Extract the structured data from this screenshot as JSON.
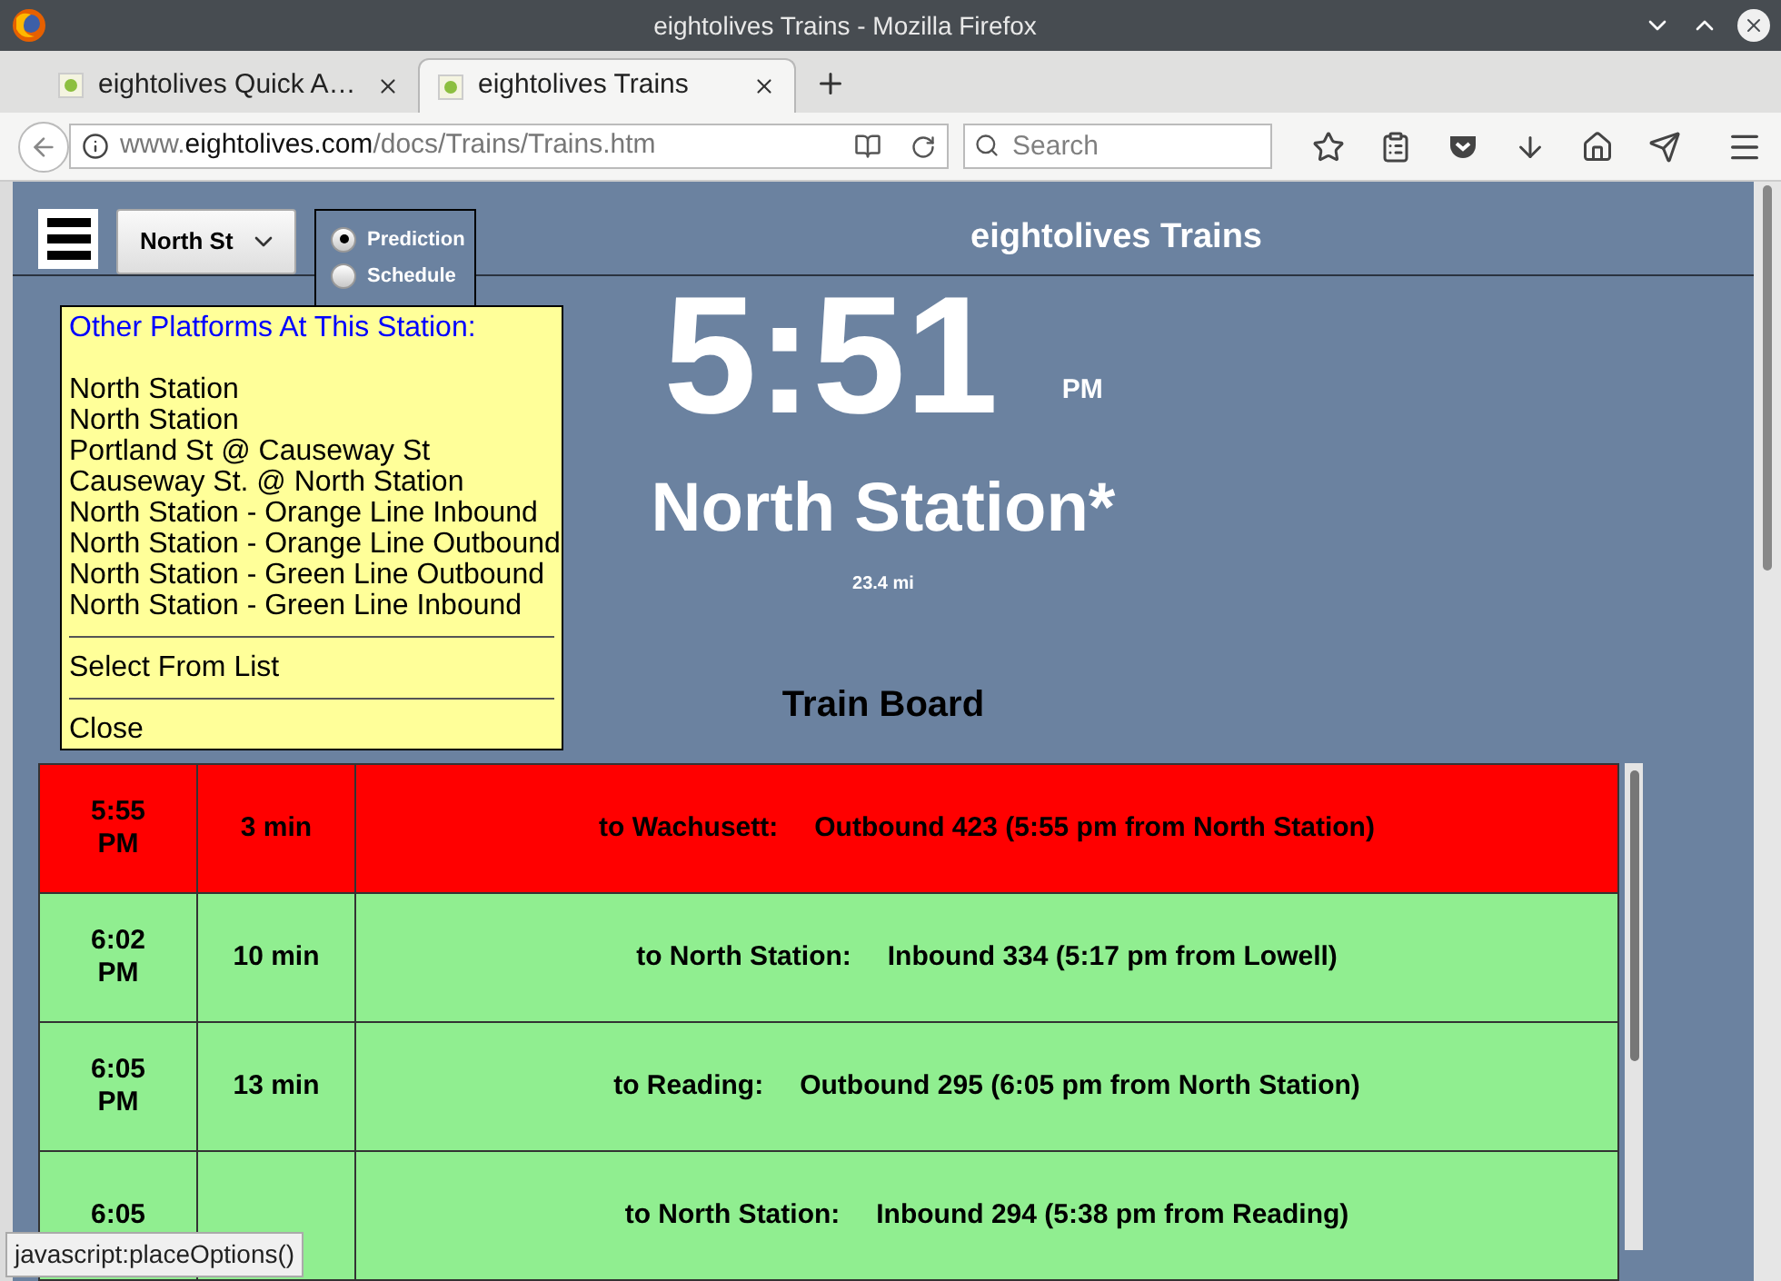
{
  "browser": {
    "window_title": "eightolives Trains - Mozilla Firefox",
    "tabs": [
      {
        "title": "eightolives Quick A…",
        "selected": false
      },
      {
        "title": "eightolives Trains",
        "selected": true
      }
    ],
    "url": {
      "prefix": "www.",
      "domain": "eightolives.com",
      "path": "/docs/Trains/Trains.htm"
    },
    "search": {
      "placeholder": "Search"
    }
  },
  "page": {
    "title": "eightolives Trains",
    "station_select": {
      "value": "North St"
    },
    "modes": [
      {
        "label": "Prediction",
        "selected": true
      },
      {
        "label": "Schedule",
        "selected": false
      }
    ],
    "clock": {
      "time": "5:51",
      "ampm": "PM"
    },
    "station": "North Station*",
    "distance": "23.4 mi",
    "board_title": "Train Board",
    "rows": [
      {
        "time": "5:55 PM",
        "minutes": "3 min",
        "destination": "to Wachusett:",
        "train": "Outbound 423 (5:55 pm from North Station)",
        "color": "#ff0000"
      },
      {
        "time": "6:02 PM",
        "minutes": "10 min",
        "destination": "to North Station:",
        "train": "Inbound 334 (5:17 pm from Lowell)",
        "color": "#90ee90"
      },
      {
        "time": "6:05 PM",
        "minutes": "13 min",
        "destination": "to Reading:",
        "train": "Outbound 295 (6:05 pm from North Station)",
        "color": "#90ee90"
      },
      {
        "time": "6:05",
        "destination": "to North Station:",
        "train": "Inbound 294 (5:38 pm from Reading)",
        "color": "#90ee90"
      }
    ],
    "popup": {
      "heading": "Other Platforms At This Station:",
      "items": [
        "North Station",
        "North Station",
        "Portland St @ Causeway St",
        "Causeway St. @ North Station",
        "North Station - Orange Line Inbound",
        "North Station - Orange Line Outbound",
        "North Station - Green Line Outbound",
        "North Station - Green Line Inbound"
      ],
      "actions": [
        "Select From List",
        "Close"
      ]
    },
    "status_bar": "javascript:placeOptions()"
  }
}
